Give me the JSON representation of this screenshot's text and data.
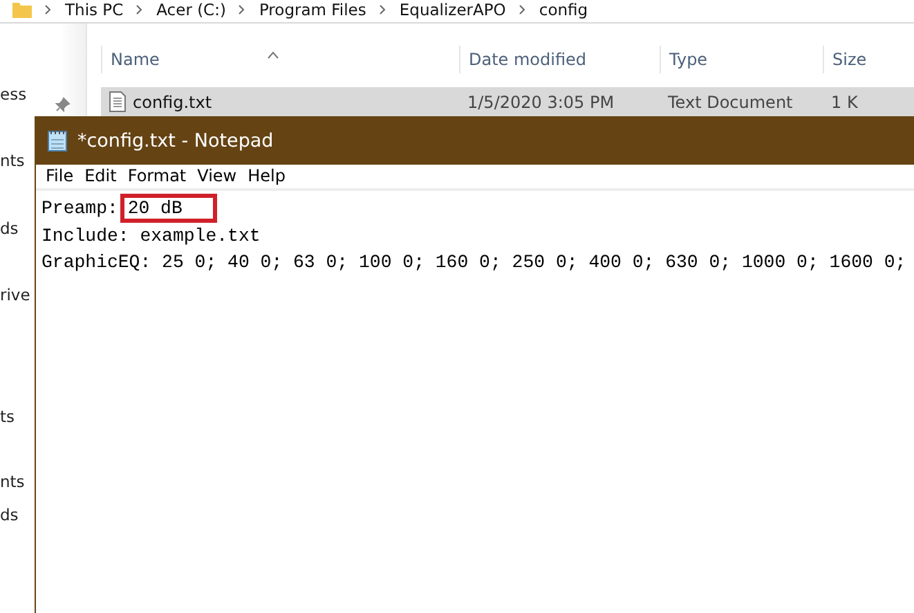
{
  "explorer": {
    "breadcrumb": [
      "This PC",
      "Acer (C:)",
      "Program Files",
      "EqualizerAPO",
      "config"
    ],
    "nav_items": [
      "ess",
      "nts",
      "ds",
      "rive",
      "ts",
      "nts",
      "ds"
    ],
    "columns": [
      "Name",
      "Date modified",
      "Type",
      "Size"
    ],
    "files": [
      {
        "name": "config.txt",
        "date": "1/5/2020 3:05 PM",
        "type": "Text Document",
        "size": "1 K",
        "selected": true
      }
    ]
  },
  "notepad": {
    "title": "*config.txt - Notepad",
    "menu": [
      "File",
      "Edit",
      "Format",
      "View",
      "Help"
    ],
    "lines": [
      {
        "text": "Preamp: ",
        "highlight": "20 dB"
      },
      {
        "text": "Include: example.txt"
      },
      {
        "text": "GraphicEQ: 25 0; 40 0; 63 0; 100 0; 160 0; 250 0; 400 0; 630 0; 1000 0; 1600 0;"
      }
    ]
  }
}
